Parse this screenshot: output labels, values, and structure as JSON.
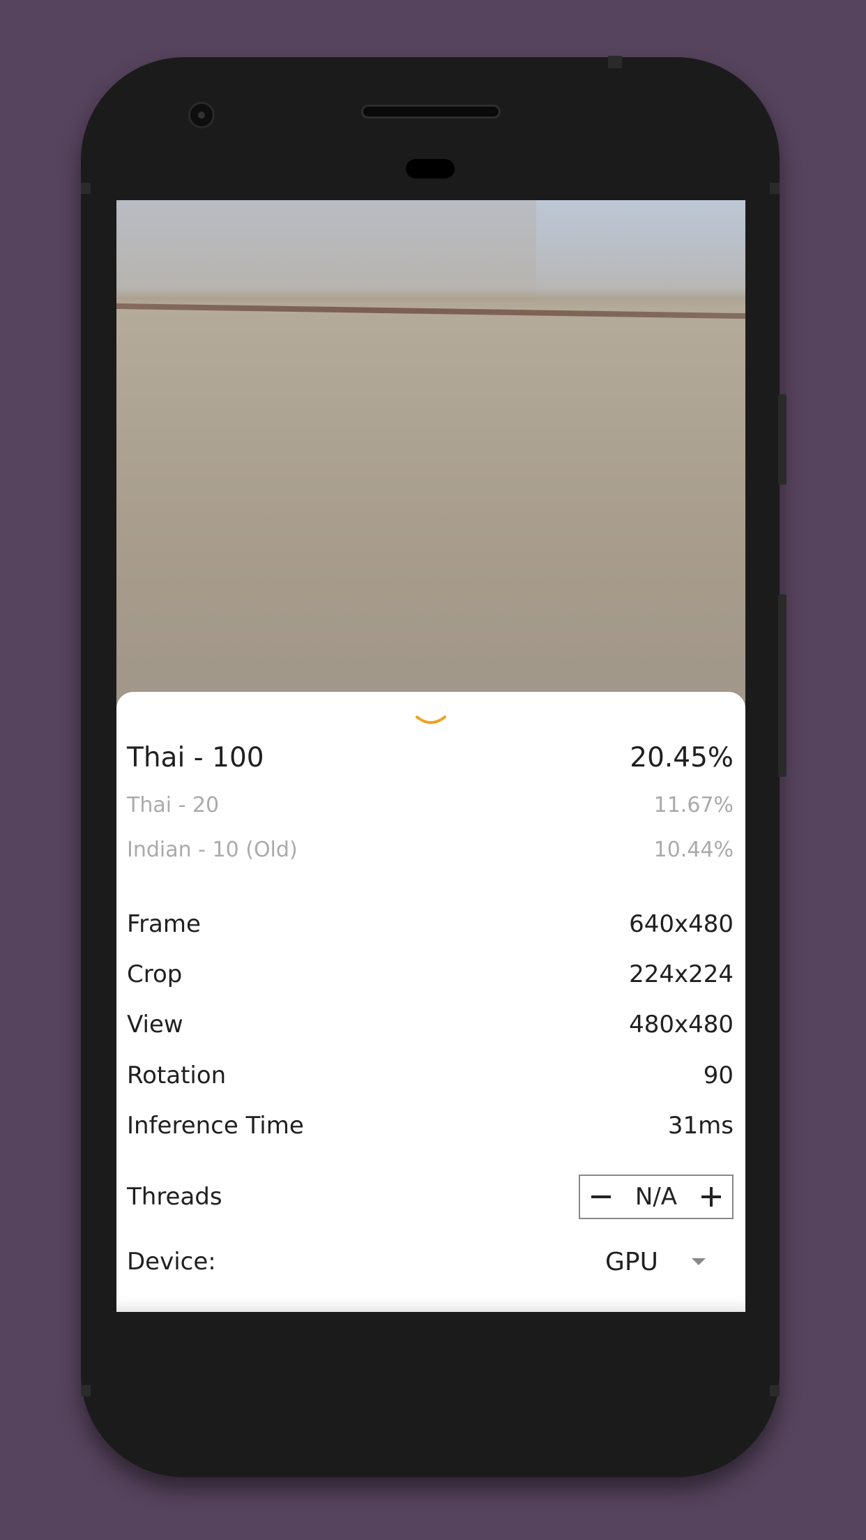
{
  "classification": {
    "top": {
      "label": "Thai - 100",
      "score": "20.45%"
    },
    "others": [
      {
        "label": "Thai - 20",
        "score": "11.67%"
      },
      {
        "label": "Indian - 10 (Old)",
        "score": "10.44%"
      }
    ]
  },
  "info": {
    "frame": {
      "label": "Frame",
      "value": "640x480"
    },
    "crop": {
      "label": "Crop",
      "value": "224x224"
    },
    "view": {
      "label": "View",
      "value": "480x480"
    },
    "rotation": {
      "label": "Rotation",
      "value": "90"
    },
    "inference": {
      "label": "Inference Time",
      "value": "31ms"
    }
  },
  "threads": {
    "label": "Threads",
    "value": "N/A"
  },
  "device": {
    "label": "Device:",
    "selected": "GPU"
  },
  "colors": {
    "background": "#56435d",
    "accent": "#f0a020",
    "sheet": "#ffffff",
    "muted_text": "#aaaaaa"
  },
  "icons": {
    "collapse": "chevron-down-icon",
    "decrement": "minus-icon",
    "increment": "plus-icon",
    "dropdown": "dropdown-arrow-icon"
  }
}
